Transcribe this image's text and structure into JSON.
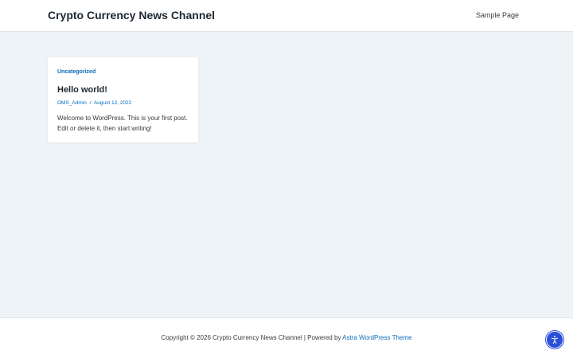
{
  "header": {
    "site_title": "Crypto Currency News Channel",
    "nav": {
      "sample_page": "Sample Page"
    }
  },
  "post": {
    "category": "Uncategorized",
    "title": "Hello world!",
    "author": "OMS_Admin",
    "separator": "/",
    "date": "August 12, 2022",
    "excerpt": "Welcome to WordPress. This is your first post. Edit or delete it, then start writing!"
  },
  "footer": {
    "copyright": "Copyright © 2026 Crypto Currency News Channel | Powered by ",
    "theme_link": "Astra WordPress Theme"
  },
  "accessibility_button": {
    "icon": "accessibility-icon"
  },
  "colors": {
    "accent": "#0b6bb8",
    "page_background": "#eef3f8",
    "accessibility_button": "#2b4fd8"
  }
}
